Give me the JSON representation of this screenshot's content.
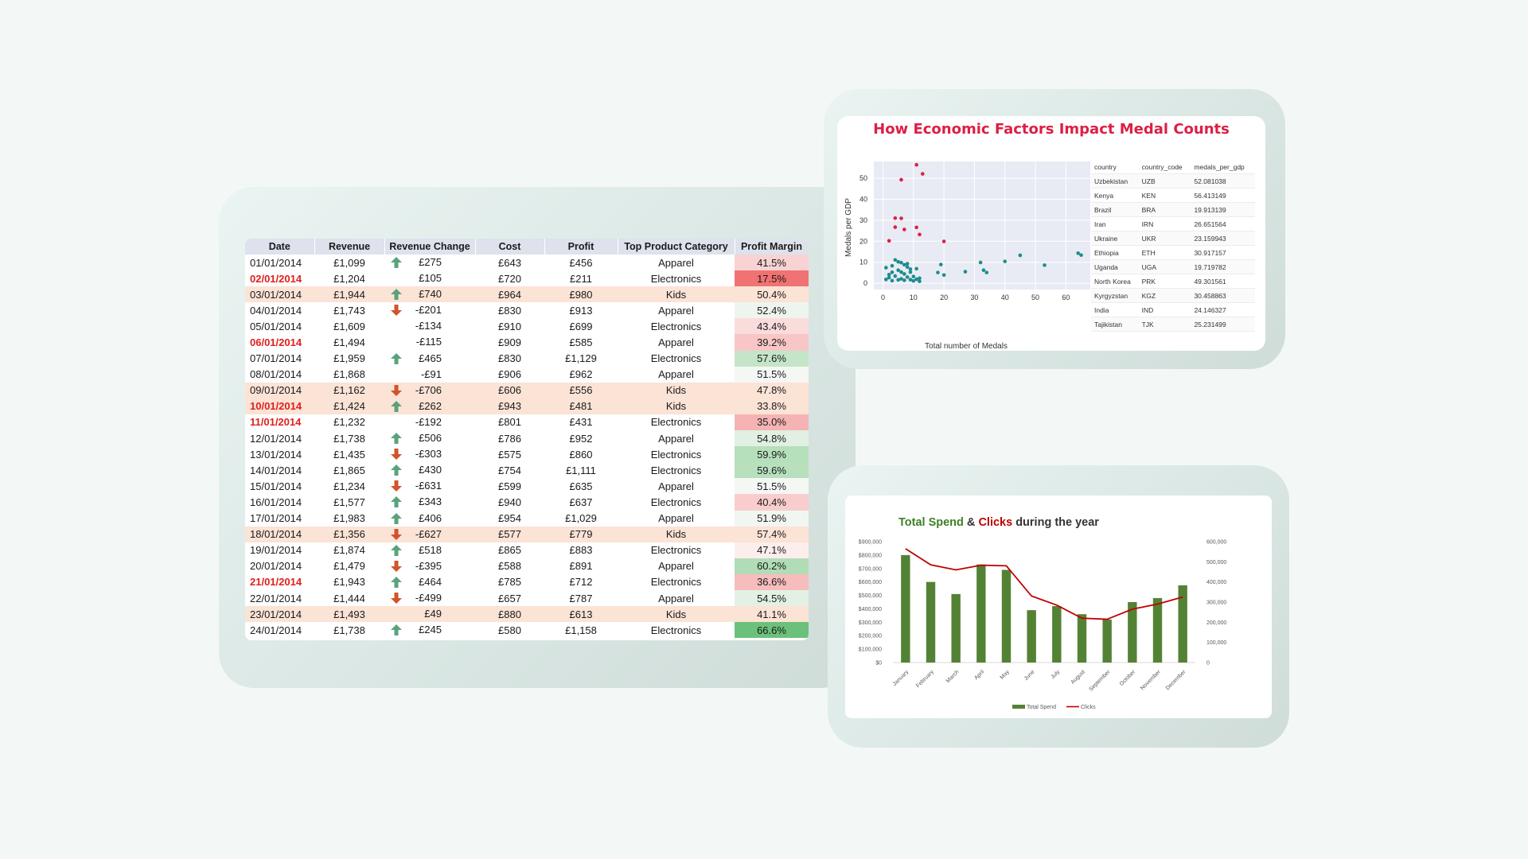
{
  "sales_table": {
    "headers": [
      "Date",
      "Revenue",
      "Revenue Change",
      "Cost",
      "Profit",
      "Top Product Category",
      "Profit Margin"
    ],
    "rows": [
      {
        "date": "01/01/2014",
        "revenue": "£1,099",
        "arrow": "up",
        "change": "£275",
        "cost": "£643",
        "profit": "£456",
        "category": "Apparel",
        "margin": "41.5%",
        "margin_color": "#f9d3d3",
        "date_red": false,
        "highlight": false
      },
      {
        "date": "02/01/2014",
        "revenue": "£1,204",
        "arrow": "none",
        "change": "£105",
        "cost": "£720",
        "profit": "£211",
        "category": "Electronics",
        "margin": "17.5%",
        "margin_color": "#f07272",
        "date_red": true,
        "highlight": false
      },
      {
        "date": "03/01/2014",
        "revenue": "£1,944",
        "arrow": "up",
        "change": "£740",
        "cost": "£964",
        "profit": "£980",
        "category": "Kids",
        "margin": "50.4%",
        "margin_color": "#fbe3d6",
        "date_red": false,
        "highlight": true
      },
      {
        "date": "04/01/2014",
        "revenue": "£1,743",
        "arrow": "down",
        "change": "-£201",
        "cost": "£830",
        "profit": "£913",
        "category": "Apparel",
        "margin": "52.4%",
        "margin_color": "#eef5ee",
        "date_red": false,
        "highlight": false
      },
      {
        "date": "05/01/2014",
        "revenue": "£1,609",
        "arrow": "none",
        "change": "-£134",
        "cost": "£910",
        "profit": "£699",
        "category": "Electronics",
        "margin": "43.4%",
        "margin_color": "#fbdcdc",
        "date_red": false,
        "highlight": false
      },
      {
        "date": "06/01/2014",
        "revenue": "£1,494",
        "arrow": "none",
        "change": "-£115",
        "cost": "£909",
        "profit": "£585",
        "category": "Apparel",
        "margin": "39.2%",
        "margin_color": "#f8c6c6",
        "date_red": true,
        "highlight": false
      },
      {
        "date": "07/01/2014",
        "revenue": "£1,959",
        "arrow": "up",
        "change": "£465",
        "cost": "£830",
        "profit": "£1,129",
        "category": "Electronics",
        "margin": "57.6%",
        "margin_color": "#c5e5c8",
        "date_red": false,
        "highlight": false
      },
      {
        "date": "08/01/2014",
        "revenue": "£1,868",
        "arrow": "none",
        "change": "-£91",
        "cost": "£906",
        "profit": "£962",
        "category": "Apparel",
        "margin": "51.5%",
        "margin_color": "#f5f7f5",
        "date_red": false,
        "highlight": false
      },
      {
        "date": "09/01/2014",
        "revenue": "£1,162",
        "arrow": "down",
        "change": "-£706",
        "cost": "£606",
        "profit": "£556",
        "category": "Kids",
        "margin": "47.8%",
        "margin_color": "#fbe3d6",
        "date_red": false,
        "highlight": true
      },
      {
        "date": "10/01/2014",
        "revenue": "£1,424",
        "arrow": "up",
        "change": "£262",
        "cost": "£943",
        "profit": "£481",
        "category": "Kids",
        "margin": "33.8%",
        "margin_color": "#fbe3d6",
        "date_red": true,
        "highlight": true
      },
      {
        "date": "11/01/2014",
        "revenue": "£1,232",
        "arrow": "none",
        "change": "-£192",
        "cost": "£801",
        "profit": "£431",
        "category": "Electronics",
        "margin": "35.0%",
        "margin_color": "#f6b3b3",
        "date_red": true,
        "highlight": false
      },
      {
        "date": "12/01/2014",
        "revenue": "£1,738",
        "arrow": "up",
        "change": "£506",
        "cost": "£786",
        "profit": "£952",
        "category": "Apparel",
        "margin": "54.8%",
        "margin_color": "#e1f0e2",
        "date_red": false,
        "highlight": false
      },
      {
        "date": "13/01/2014",
        "revenue": "£1,435",
        "arrow": "down",
        "change": "-£303",
        "cost": "£575",
        "profit": "£860",
        "category": "Electronics",
        "margin": "59.9%",
        "margin_color": "#b6dfbb",
        "date_red": false,
        "highlight": false
      },
      {
        "date": "14/01/2014",
        "revenue": "£1,865",
        "arrow": "up",
        "change": "£430",
        "cost": "£754",
        "profit": "£1,111",
        "category": "Electronics",
        "margin": "59.6%",
        "margin_color": "#b8e0bd",
        "date_red": false,
        "highlight": false
      },
      {
        "date": "15/01/2014",
        "revenue": "£1,234",
        "arrow": "down",
        "change": "-£631",
        "cost": "£599",
        "profit": "£635",
        "category": "Apparel",
        "margin": "51.5%",
        "margin_color": "#f5f7f5",
        "date_red": false,
        "highlight": false
      },
      {
        "date": "16/01/2014",
        "revenue": "£1,577",
        "arrow": "up",
        "change": "£343",
        "cost": "£940",
        "profit": "£637",
        "category": "Electronics",
        "margin": "40.4%",
        "margin_color": "#f9cdcd",
        "date_red": false,
        "highlight": false
      },
      {
        "date": "17/01/2014",
        "revenue": "£1,983",
        "arrow": "up",
        "change": "£406",
        "cost": "£954",
        "profit": "£1,029",
        "category": "Apparel",
        "margin": "51.9%",
        "margin_color": "#f2f6f2",
        "date_red": false,
        "highlight": false
      },
      {
        "date": "18/01/2014",
        "revenue": "£1,356",
        "arrow": "down",
        "change": "-£627",
        "cost": "£577",
        "profit": "£779",
        "category": "Kids",
        "margin": "57.4%",
        "margin_color": "#fbe3d6",
        "date_red": false,
        "highlight": true
      },
      {
        "date": "19/01/2014",
        "revenue": "£1,874",
        "arrow": "up",
        "change": "£518",
        "cost": "£865",
        "profit": "£883",
        "category": "Electronics",
        "margin": "47.1%",
        "margin_color": "#fdeeee",
        "date_red": false,
        "highlight": false
      },
      {
        "date": "20/01/2014",
        "revenue": "£1,479",
        "arrow": "down",
        "change": "-£395",
        "cost": "£588",
        "profit": "£891",
        "category": "Apparel",
        "margin": "60.2%",
        "margin_color": "#b1ddb6",
        "date_red": false,
        "highlight": false
      },
      {
        "date": "21/01/2014",
        "revenue": "£1,943",
        "arrow": "up",
        "change": "£464",
        "cost": "£785",
        "profit": "£712",
        "category": "Electronics",
        "margin": "36.6%",
        "margin_color": "#f7bcbc",
        "date_red": true,
        "highlight": false
      },
      {
        "date": "22/01/2014",
        "revenue": "£1,444",
        "arrow": "down",
        "change": "-£499",
        "cost": "£657",
        "profit": "£787",
        "category": "Apparel",
        "margin": "54.5%",
        "margin_color": "#e3f1e4",
        "date_red": false,
        "highlight": false
      },
      {
        "date": "23/01/2014",
        "revenue": "£1,493",
        "arrow": "none",
        "change": "£49",
        "cost": "£880",
        "profit": "£613",
        "category": "Kids",
        "margin": "41.1%",
        "margin_color": "#fbe3d6",
        "date_red": false,
        "highlight": true
      },
      {
        "date": "24/01/2014",
        "revenue": "£1,738",
        "arrow": "up",
        "change": "£245",
        "cost": "£580",
        "profit": "£1,158",
        "category": "Electronics",
        "margin": "66.6%",
        "margin_color": "#6cc17a",
        "date_red": false,
        "highlight": false
      }
    ]
  },
  "chart_data": [
    {
      "type": "scatter",
      "title": "How Economic Factors Impact Medal Counts",
      "xlabel": "Total number of Medals",
      "ylabel": "Medals per GDP",
      "xlim": [
        -3,
        68
      ],
      "ylim": [
        -3,
        58
      ],
      "xticks": [
        0,
        10,
        20,
        30,
        40,
        50,
        60
      ],
      "yticks": [
        0,
        10,
        20,
        30,
        40,
        50
      ],
      "series": [
        {
          "color": "#dc1f45",
          "points": [
            [
              6,
              49.3
            ],
            [
              11,
              56.4
            ],
            [
              13,
              52.1
            ],
            [
              2,
              20.2
            ],
            [
              4,
              26.7
            ],
            [
              4,
              31.0
            ],
            [
              6,
              30.9
            ],
            [
              7,
              25.6
            ],
            [
              11,
              26.6
            ],
            [
              12,
              23.2
            ],
            [
              20,
              19.9
            ]
          ]
        },
        {
          "color": "#1b8c8c",
          "points": [
            [
              1,
              7.4
            ],
            [
              2,
              4.1
            ],
            [
              3,
              8.3
            ],
            [
              4,
              11.1
            ],
            [
              5,
              6.2
            ],
            [
              6,
              9.8
            ],
            [
              7,
              4.4
            ],
            [
              8,
              7.7
            ],
            [
              9,
              5.3
            ],
            [
              10,
              3.2
            ],
            [
              11,
              6.9
            ],
            [
              12,
              2.4
            ],
            [
              1,
              1.8
            ],
            [
              2,
              2.7
            ],
            [
              3,
              1.2
            ],
            [
              4,
              3.4
            ],
            [
              5,
              1.6
            ],
            [
              6,
              2.1
            ],
            [
              7,
              1.4
            ],
            [
              8,
              2.9
            ],
            [
              9,
              1.7
            ],
            [
              10,
              1.1
            ],
            [
              11,
              1.9
            ],
            [
              12,
              0.9
            ],
            [
              5,
              10.2
            ],
            [
              6,
              5.3
            ],
            [
              7,
              8.8
            ],
            [
              8,
              9.3
            ],
            [
              9,
              6.7
            ],
            [
              3,
              5.2
            ],
            [
              18,
              5.1
            ],
            [
              19,
              8.9
            ],
            [
              20,
              3.9
            ],
            [
              27,
              5.5
            ],
            [
              32,
              9.9
            ],
            [
              33,
              6.2
            ],
            [
              34,
              5.1
            ],
            [
              40,
              10.4
            ],
            [
              45,
              13.3
            ],
            [
              53,
              8.6
            ],
            [
              64,
              14.3
            ],
            [
              65,
              13.4
            ]
          ]
        }
      ]
    },
    {
      "type": "bar+line",
      "title_parts": [
        {
          "text": "Total Spend",
          "color": "#3e7f24"
        },
        {
          "text": " & ",
          "color": "#333333"
        },
        {
          "text": "Clicks",
          "color": "#c00000"
        },
        {
          "text": " during the year",
          "color": "#333333"
        }
      ],
      "categories": [
        "January",
        "February",
        "March",
        "April",
        "May",
        "June",
        "July",
        "August",
        "September",
        "October",
        "November",
        "December"
      ],
      "series": [
        {
          "name": "Total Spend",
          "type": "bar",
          "axis": "left",
          "color": "#548235",
          "values": [
            800000,
            600000,
            510000,
            730000,
            690000,
            390000,
            420000,
            360000,
            320000,
            450000,
            480000,
            575000
          ]
        },
        {
          "name": "Clicks",
          "type": "line",
          "axis": "right",
          "color": "#c00000",
          "values": [
            565000,
            485000,
            460000,
            483000,
            480000,
            330000,
            285000,
            220000,
            215000,
            265000,
            290000,
            325000
          ]
        }
      ],
      "left_ticks": [
        "$0",
        "$100,000",
        "$200,000",
        "$300,000",
        "$400,000",
        "$500,000",
        "$600,000",
        "$700,000",
        "$800,000",
        "$900,000"
      ],
      "right_ticks": [
        "0",
        "100,000",
        "200,000",
        "300,000",
        "400,000",
        "500,000",
        "600,000"
      ],
      "left_max": 900000,
      "right_max": 600000
    }
  ],
  "medals_table": {
    "headers": [
      "country",
      "country_code",
      "medals_per_gdp"
    ],
    "rows": [
      [
        "Uzbekistan",
        "UZB",
        "52.081038"
      ],
      [
        "Kenya",
        "KEN",
        "56.413149"
      ],
      [
        "Brazil",
        "BRA",
        "19.913139"
      ],
      [
        "Iran",
        "IRN",
        "26.651564"
      ],
      [
        "Ukraine",
        "UKR",
        "23.159943"
      ],
      [
        "Ethiopia",
        "ETH",
        "30.917157"
      ],
      [
        "Uganda",
        "UGA",
        "19.719782"
      ],
      [
        "North Korea",
        "PRK",
        "49.301561"
      ],
      [
        "Kyrgyzstan",
        "KGZ",
        "30.458863"
      ],
      [
        "India",
        "IND",
        "24.146327"
      ],
      [
        "Tajikistan",
        "TJK",
        "25.231499"
      ]
    ]
  },
  "arrow_colors": {
    "up": "#5aa37a",
    "down": "#d0542a"
  }
}
